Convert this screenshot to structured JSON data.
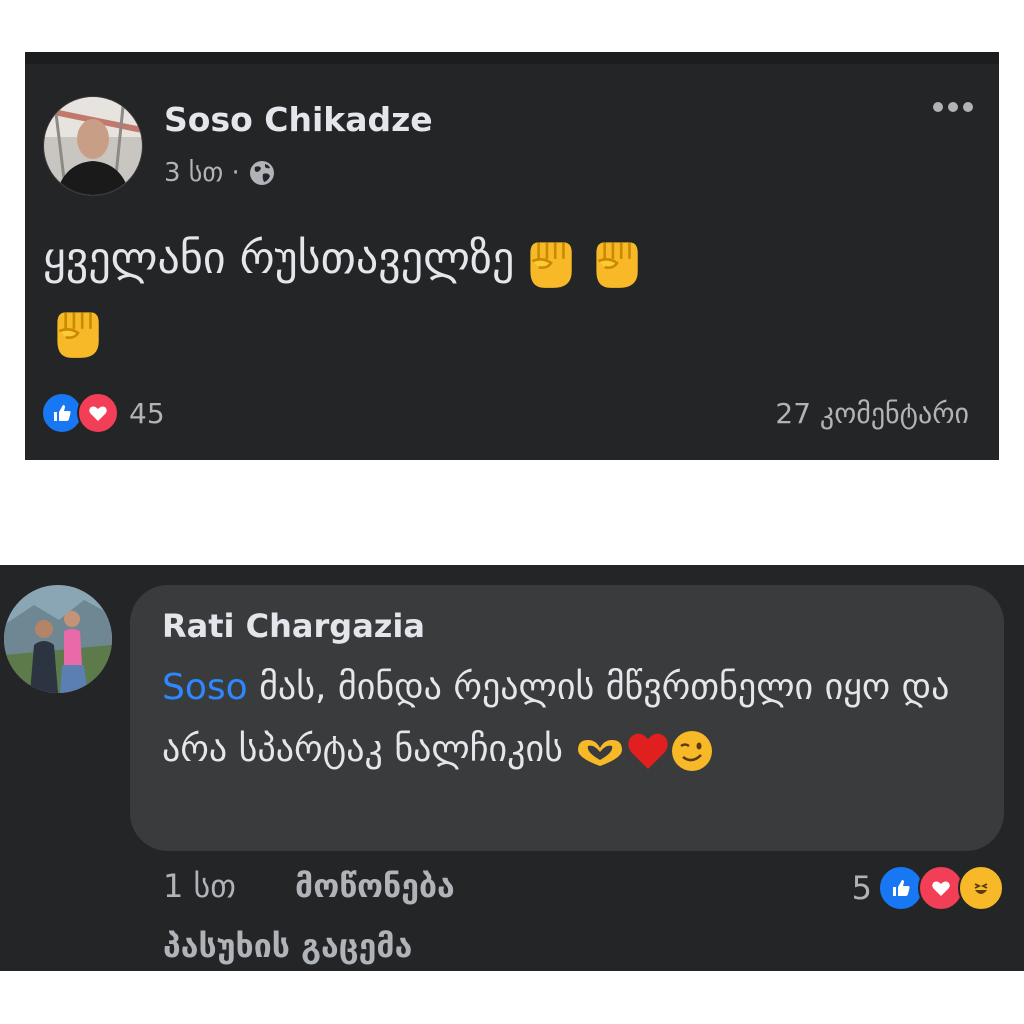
{
  "post": {
    "author": "Soso Chikadze",
    "time": "3 სთ ·",
    "text": "ყველანი რუსთაველზე",
    "reaction_count": "45",
    "comments_label": "27 კომენტარი",
    "icons": [
      "globe-icon",
      "more-icon",
      "raised-fist-emoji",
      "like-icon",
      "love-icon"
    ]
  },
  "comment": {
    "author": "Rati Chargazia",
    "mention": "Soso",
    "text": "მას, მინდა რეალის მწვრთნელი იყო და არა სპარტაკ ნალჩიკის",
    "time": "1 სთ",
    "like_label": "მოწონება",
    "reply_label": "პასუხის გაცემა",
    "reaction_count": "5",
    "icons": [
      "heart-hands-emoji",
      "red-heart-emoji",
      "winking-face-emoji",
      "like-icon",
      "love-icon",
      "haha-icon"
    ]
  },
  "colors": {
    "card_bg": "#242526",
    "bubble_bg": "#3a3b3c",
    "text_primary": "#e4e6eb",
    "text_secondary": "#b0b3b8",
    "mention": "#2d88ff",
    "like_blue": "#1877f2",
    "love_red": "#f33e58"
  }
}
